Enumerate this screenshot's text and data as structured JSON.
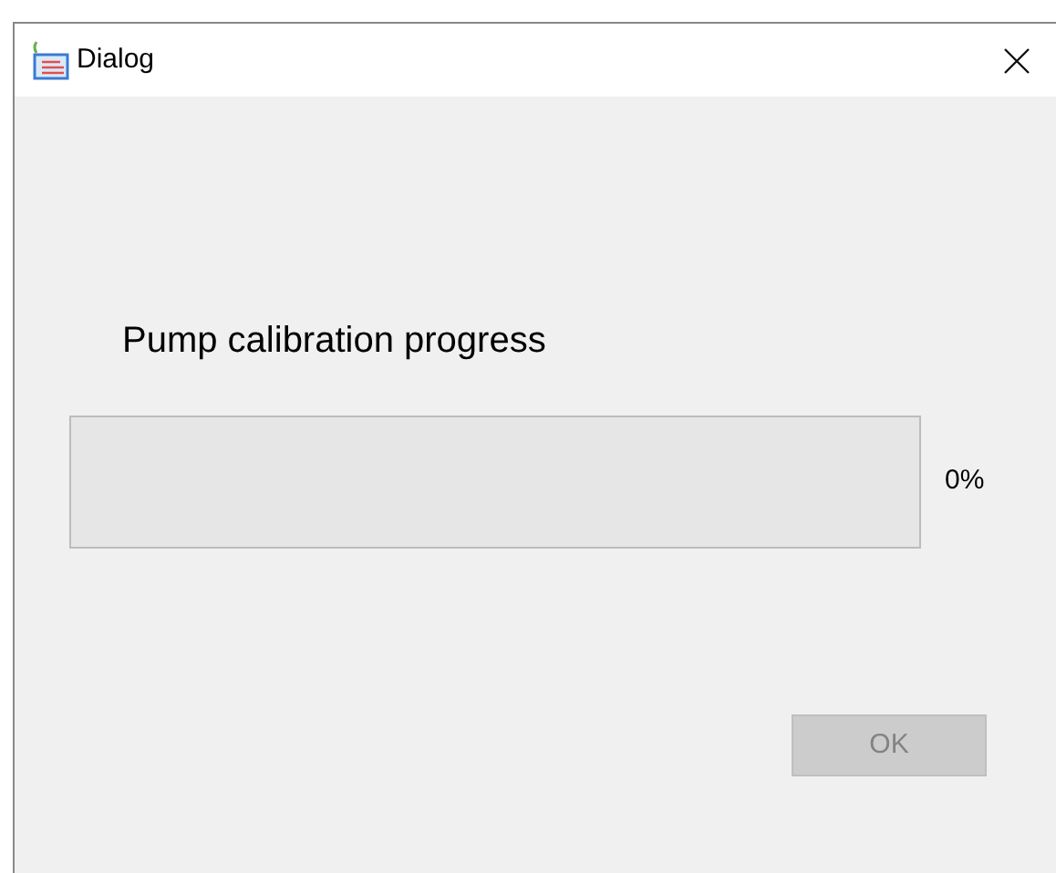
{
  "window": {
    "title": "Dialog"
  },
  "heading": "Pump calibration progress",
  "progress": {
    "level": 0,
    "reading": "0%"
  },
  "ok_button": {
    "label": "OK",
    "disabled": true
  }
}
